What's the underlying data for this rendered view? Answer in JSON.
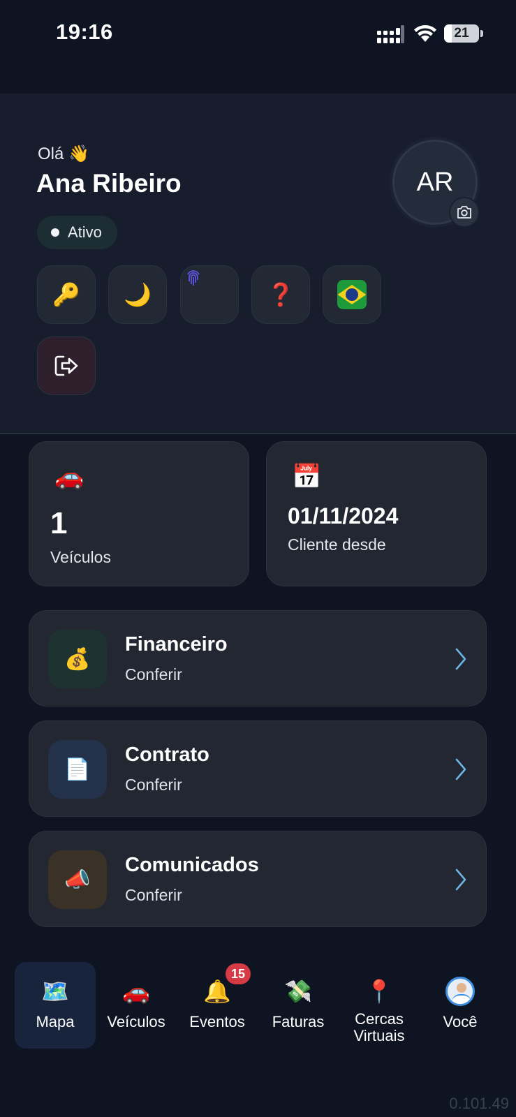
{
  "status_bar": {
    "time": "19:16",
    "battery": "21",
    "battery_level_percent": 21
  },
  "profile": {
    "greeting": "Olá 👋",
    "name": "Ana Ribeiro",
    "status": "Ativo",
    "avatar_initials": "AR"
  },
  "quick_actions": [
    {
      "icon": "key-icon",
      "glyph": "🔑"
    },
    {
      "icon": "moon-icon",
      "glyph": "🌙"
    },
    {
      "icon": "fingerprint-icon",
      "glyph": ""
    },
    {
      "icon": "help-icon",
      "glyph": "❓"
    },
    {
      "icon": "brazil-flag-icon",
      "glyph": ""
    },
    {
      "icon": "logout-icon",
      "glyph": ""
    }
  ],
  "stats": {
    "vehicles": {
      "icon": "🚗",
      "value": "1",
      "label": "Veículos"
    },
    "client_since": {
      "icon": "📅",
      "value": "01/11/2024",
      "label": "Cliente desde"
    }
  },
  "menu": [
    {
      "icon": "💰",
      "title": "Financeiro",
      "subtitle": "Conferir",
      "icon_bg": "#1f3232"
    },
    {
      "icon": "📄",
      "title": "Contrato",
      "subtitle": "Conferir",
      "icon_bg": "#23324a"
    },
    {
      "icon": "📣",
      "title": "Comunicados",
      "subtitle": "Conferir",
      "icon_bg": "#3a3226"
    }
  ],
  "bottom_nav": [
    {
      "icon": "🗺️",
      "label": "Mapa",
      "active": true
    },
    {
      "icon": "🚗",
      "label": "Veículos"
    },
    {
      "icon": "🔔",
      "label": "Eventos",
      "badge": "15"
    },
    {
      "icon": "💸",
      "label": "Faturas"
    },
    {
      "icon": "📍",
      "label": "Cercas Virtuais"
    },
    {
      "icon": "avatar",
      "label": "Você"
    }
  ],
  "version": "0.101.49",
  "colors": {
    "background": "#0e1422",
    "card": "#222731",
    "accent_chevron": "#6fb4e6",
    "badge": "#d63a45"
  }
}
